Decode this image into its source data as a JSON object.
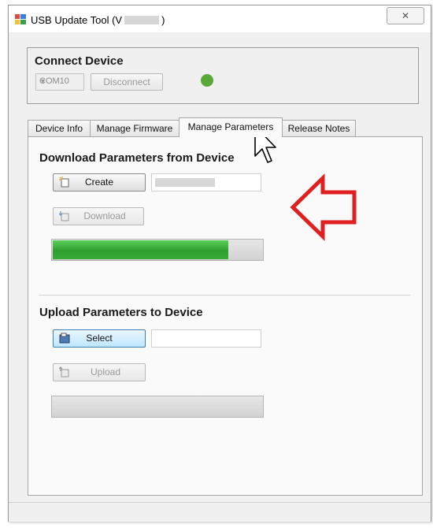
{
  "window": {
    "title": "USB Update Tool  (V",
    "title_suffix": ")",
    "close_glyph": "✕"
  },
  "connect": {
    "title": "Connect Device",
    "port": "COM10",
    "disconnect_label": "Disconnect",
    "status_color": "#59a93a"
  },
  "tabs": [
    {
      "label": "Device Info",
      "active": false
    },
    {
      "label": "Manage Firmware",
      "active": false
    },
    {
      "label": "Manage Parameters",
      "active": true
    },
    {
      "label": "Release Notes",
      "active": false
    }
  ],
  "download": {
    "title": "Download Parameters from Device",
    "create_label": "Create",
    "download_label": "Download",
    "progress": 0.84
  },
  "upload": {
    "title": "Upload Parameters to Device",
    "select_label": "Select",
    "upload_label": "Upload",
    "progress": 0
  },
  "colors": {
    "annotation_arrow": "#e02020",
    "progress_green": "#2f9e2f"
  }
}
